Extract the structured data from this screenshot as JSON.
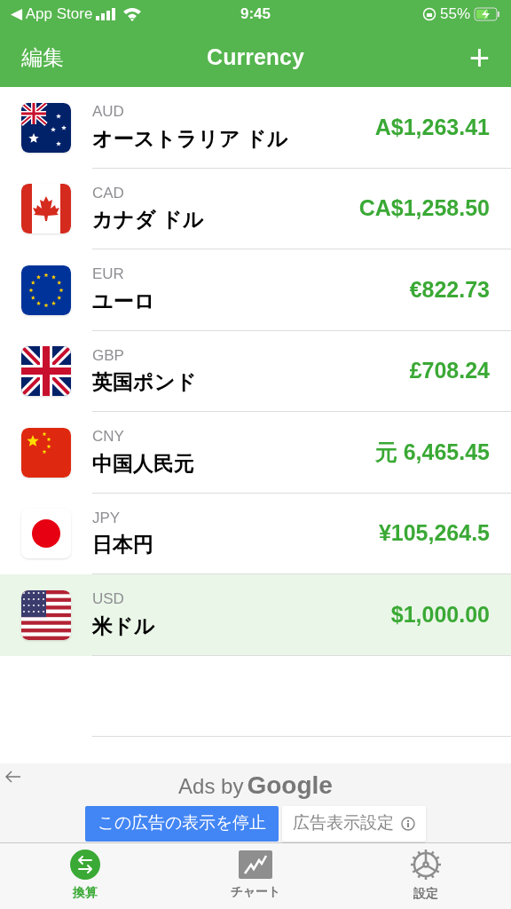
{
  "status_bar": {
    "back_label": "◀ App Store",
    "time": "9:45",
    "battery": "55%"
  },
  "nav": {
    "edit": "編集",
    "title": "Currency",
    "add": "+"
  },
  "currencies": [
    {
      "kind": "au",
      "code": "AUD",
      "name": "オーストラリア ドル",
      "amount": "A$1,263.41",
      "selected": false
    },
    {
      "kind": "ca",
      "code": "CAD",
      "name": "カナダ ドル",
      "amount": "CA$1,258.50",
      "selected": false
    },
    {
      "kind": "eu",
      "code": "EUR",
      "name": "ユーロ",
      "amount": "€822.73",
      "selected": false
    },
    {
      "kind": "gb",
      "code": "GBP",
      "name": "英国ポンド",
      "amount": "£708.24",
      "selected": false
    },
    {
      "kind": "cn",
      "code": "CNY",
      "name": "中国人民元",
      "amount": "元 6,465.45",
      "selected": false
    },
    {
      "kind": "jp",
      "code": "JPY",
      "name": "日本円",
      "amount": "¥105,264.5",
      "selected": false
    },
    {
      "kind": "us",
      "code": "USD",
      "name": "米ドル",
      "amount": "$1,000.00",
      "selected": true
    }
  ],
  "ad": {
    "ads_by": "Ads by",
    "brand": "Google",
    "stop_button": "この広告の表示を停止",
    "settings_button": "広告表示設定"
  },
  "tabs": [
    {
      "kind": "convert",
      "label": "換算",
      "selected": true
    },
    {
      "kind": "chart",
      "label": "チャート",
      "selected": false
    },
    {
      "kind": "settings",
      "label": "設定",
      "selected": false
    }
  ]
}
